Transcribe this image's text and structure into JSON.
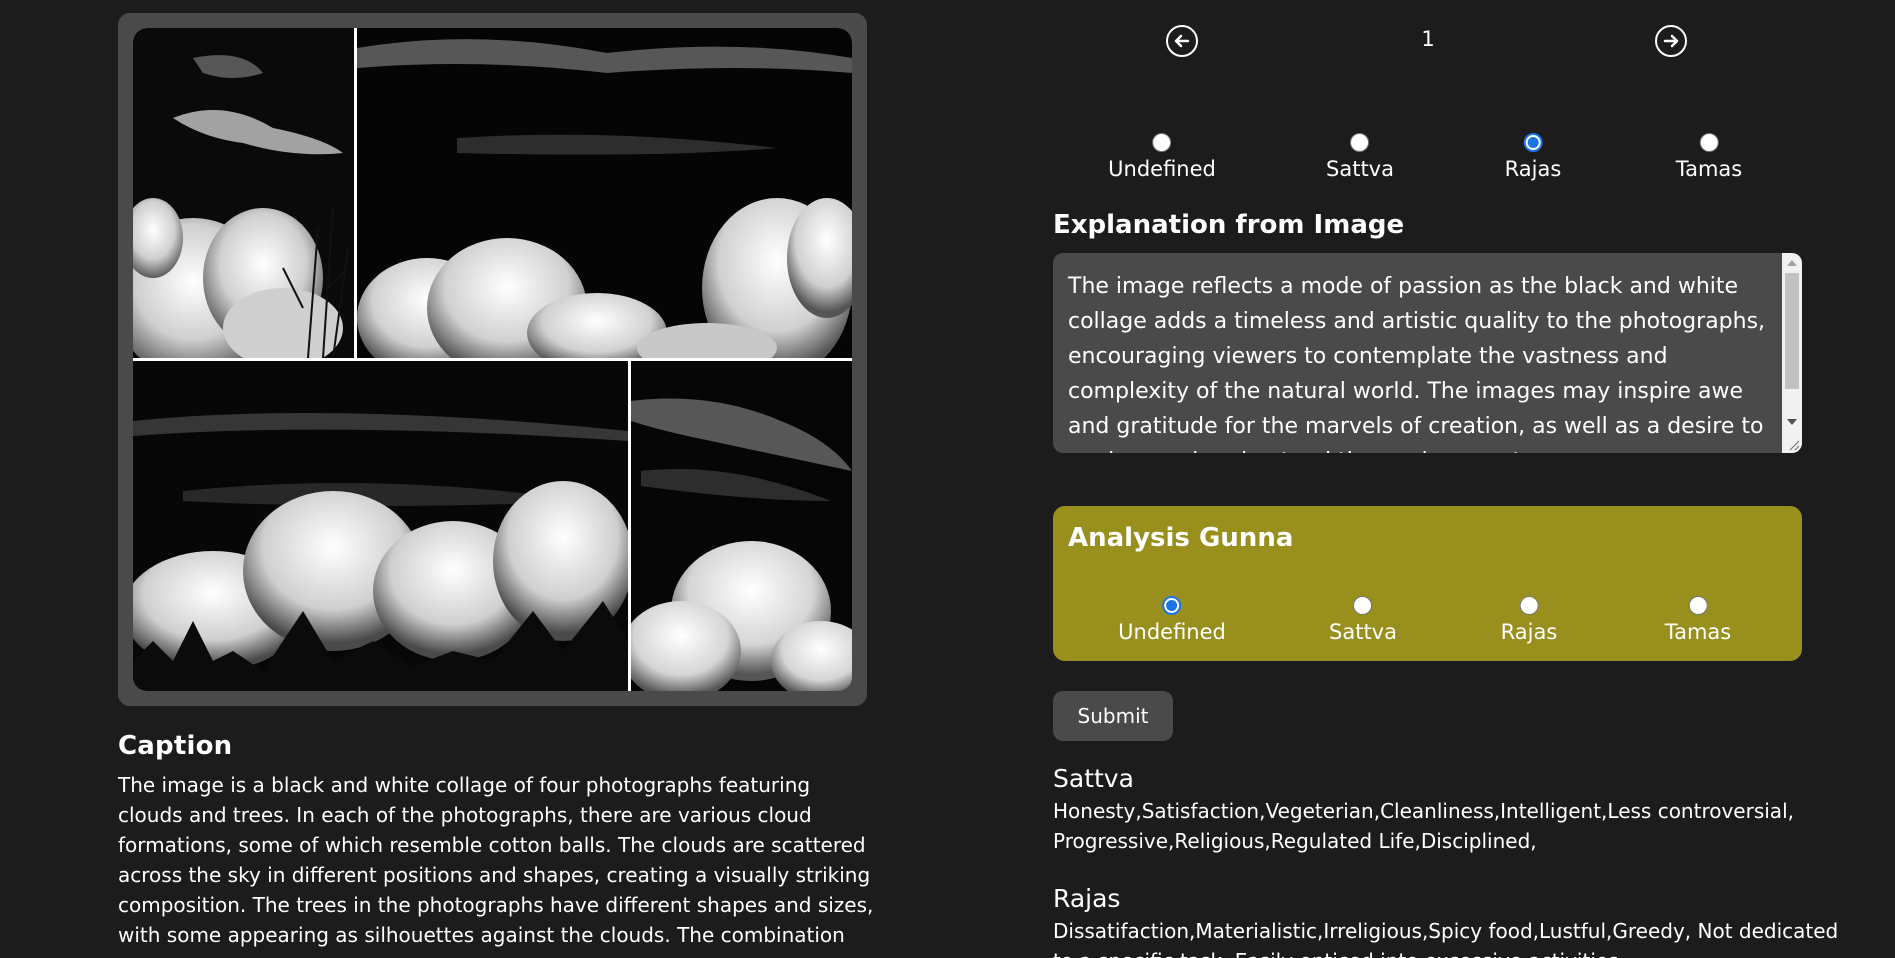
{
  "caption": {
    "title": "Caption",
    "text": "The image is a black and white collage of four photographs featuring clouds and trees. In each of the photographs, there are various cloud formations, some of which resemble cotton balls. The clouds are scattered across the sky in different positions and shapes, creating a visually striking composition. The trees in the photographs have different shapes and sizes, with some appearing as silhouettes against the clouds. The combination"
  },
  "navigation": {
    "page_number": "1",
    "prev_icon": "arrow-left-circle-icon",
    "next_icon": "arrow-right-circle-icon"
  },
  "top_radio": {
    "options": [
      "Undefined",
      "Sattva",
      "Rajas",
      "Tamas"
    ],
    "selected": "Rajas"
  },
  "explanation": {
    "title": "Explanation from Image",
    "text": " The image reflects a mode of passion as the black and white collage adds a timeless and artistic quality to the photographs, encouraging viewers to contemplate the vastness and complexity of the natural world. The images may inspire awe and gratitude for the marvels of creation, as well as a desire to explore and understand the environment."
  },
  "analysis": {
    "title": "Analysis Gunna",
    "options": [
      "Undefined",
      "Sattva",
      "Rajas",
      "Tamas"
    ],
    "selected": "Undefined",
    "background_color": "#998f1d"
  },
  "submit": {
    "label": "Submit"
  },
  "gunas": {
    "sattva": {
      "title": "Sattva",
      "text": "Honesty,Satisfaction,Vegeterian,Cleanliness,Intelligent,Less controversial, Progressive,Religious,Regulated Life,Disciplined,"
    },
    "rajas": {
      "title": "Rajas",
      "text": "Dissatifaction,Materialistic,Irreligious,Spicy food,Lustful,Greedy, Not dedicated to a specific task, Easily enticed into excessive activities"
    }
  },
  "colors": {
    "background": "#1c1c1c",
    "panel": "#4a4a4a",
    "radio_accent": "#1a73e8"
  }
}
